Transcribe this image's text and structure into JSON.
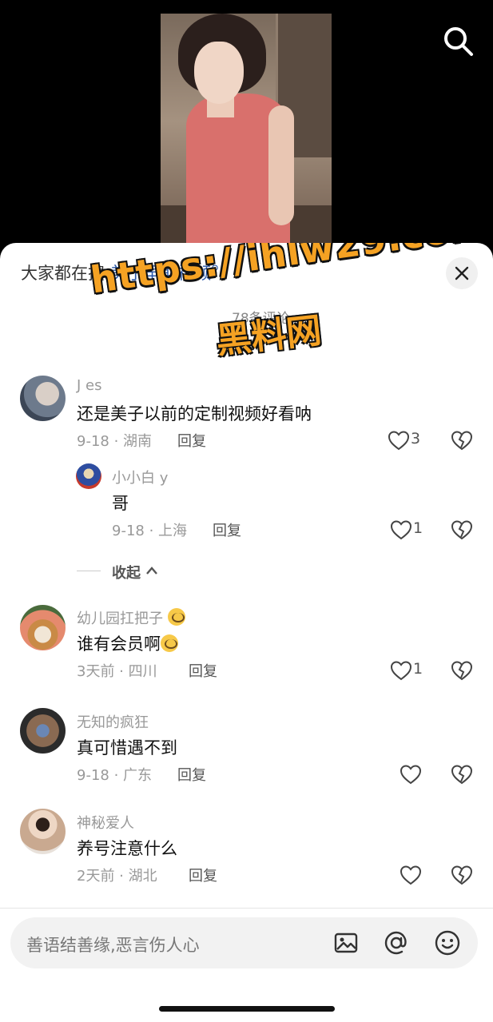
{
  "header": {
    "hot_search_prefix": "大家都在搜:",
    "hot_search_keyword": "美子早期视频",
    "comment_count_text": "78条评论"
  },
  "watermark": {
    "url": "https://ihlw29.com",
    "name": "黑料网"
  },
  "comments": [
    {
      "user": "J es",
      "text": "还是美子以前的定制视频好看呐",
      "meta": "9-18 · 湖南",
      "reply": "回复",
      "likes": "3"
    },
    {
      "user": "小小白 y",
      "text": "哥",
      "meta": "9-18 · 上海",
      "reply": "回复",
      "likes": "1"
    },
    {
      "user": "幼儿园扛把子",
      "text": "谁有会员啊",
      "meta": "3天前 · 四川",
      "reply": "回复",
      "likes": "1"
    },
    {
      "user": "无知的疯狂",
      "text": "真可惜遇不到",
      "meta": "9-18 · 广东",
      "reply": "回复",
      "likes": ""
    },
    {
      "user": "神秘爱人",
      "text": "养号注意什么",
      "meta": "2天前 · 湖北",
      "reply": "回复",
      "likes": ""
    }
  ],
  "collapse_label": "收起",
  "input": {
    "placeholder": "善语结善缘,恶言伤人心"
  },
  "icons": [
    "search-icon",
    "close-icon",
    "heart-icon",
    "broken-heart-icon",
    "image-icon",
    "at-icon",
    "emoji-icon",
    "chevron-up-icon"
  ]
}
